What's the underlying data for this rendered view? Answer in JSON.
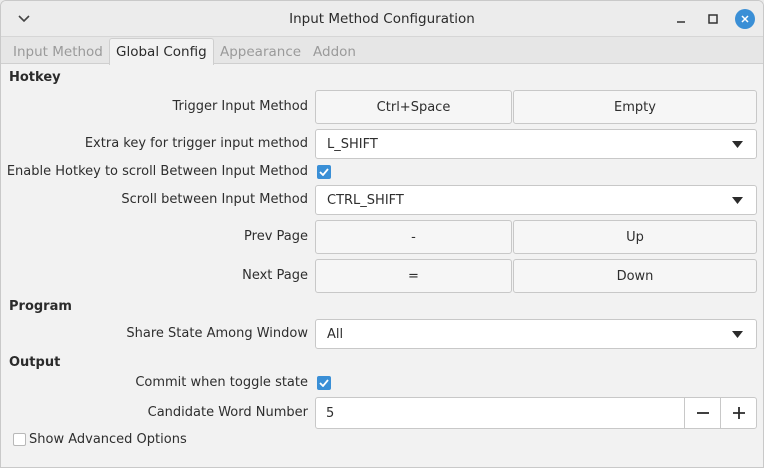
{
  "window": {
    "title": "Input Method Configuration"
  },
  "tabs": [
    {
      "label": "Input Method",
      "active": false
    },
    {
      "label": "Global Config",
      "active": true
    },
    {
      "label": "Appearance",
      "active": false
    },
    {
      "label": "Addon",
      "active": false
    }
  ],
  "hotkey": {
    "section_title": "Hotkey",
    "trigger": {
      "label": "Trigger Input Method",
      "key1": "Ctrl+Space",
      "key2": "Empty"
    },
    "extra_key": {
      "label": "Extra key for trigger input method",
      "value": "L_SHIFT"
    },
    "enable_scroll": {
      "label": "Enable Hotkey to scroll Between Input Method",
      "checked": true
    },
    "scroll_between": {
      "label": "Scroll between Input Method",
      "value": "CTRL_SHIFT"
    },
    "prev_page": {
      "label": "Prev Page",
      "key1": "-",
      "key2": "Up"
    },
    "next_page": {
      "label": "Next Page",
      "key1": "=",
      "key2": "Down"
    }
  },
  "program": {
    "section_title": "Program",
    "share_state": {
      "label": "Share State Among Window",
      "value": "All"
    }
  },
  "output": {
    "section_title": "Output",
    "commit_toggle": {
      "label": "Commit when toggle state",
      "checked": true
    },
    "candidate_number": {
      "label": "Candidate Word Number",
      "value": "5"
    }
  },
  "advanced": {
    "label": "Show Advanced Options",
    "checked": false
  },
  "colors": {
    "accent": "#3a8fd6"
  }
}
